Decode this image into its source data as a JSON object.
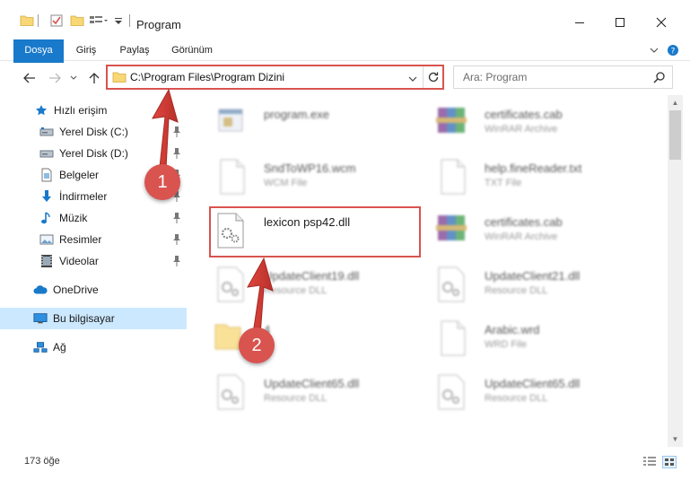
{
  "window": {
    "title": "Program",
    "controls": {
      "minimize": "—",
      "maximize": "☐",
      "close": "✕"
    }
  },
  "ribbon": {
    "tabs": [
      "Dosya",
      "Giriş",
      "Paylaş",
      "Görünüm"
    ]
  },
  "address_bar": {
    "path": "C:\\Program Files\\Program Dizini"
  },
  "search": {
    "placeholder": "Ara: Program"
  },
  "navigation": {
    "quick_access": "Hızlı erişim",
    "items": [
      {
        "label": "Yerel Disk (C:)",
        "icon": "drive-icon"
      },
      {
        "label": "Yerel Disk (D:)",
        "icon": "drive-icon"
      },
      {
        "label": "Belgeler",
        "icon": "documents-icon"
      },
      {
        "label": "İndirmeler",
        "icon": "downloads-icon"
      },
      {
        "label": "Müzik",
        "icon": "music-icon"
      },
      {
        "label": "Resimler",
        "icon": "pictures-icon"
      },
      {
        "label": "Videolar",
        "icon": "videos-icon"
      }
    ],
    "onedrive": "OneDrive",
    "this_pc": "Bu bilgisayar",
    "network": "Ağ"
  },
  "files": {
    "left": [
      {
        "name": "program.exe",
        "type": ""
      },
      {
        "name": "SndToWP16.wcm",
        "type": "WCM File"
      },
      {
        "name": "lexicon psp42.dll",
        "type": ""
      },
      {
        "name": "UpdateClient19.dll",
        "type": "Resource DLL"
      },
      {
        "name": "4",
        "type": ""
      },
      {
        "name": "UpdateClient65.dll",
        "type": "Resource DLL"
      }
    ],
    "right": [
      {
        "name": "certificates.cab",
        "type": "WinRAR Archive"
      },
      {
        "name": "help.fineReader.txt",
        "type": "TXT File"
      },
      {
        "name": "certificates.cab",
        "type": "WinRAR Archive"
      },
      {
        "name": "UpdateClient21.dll",
        "type": "Resource DLL"
      },
      {
        "name": "Arabic.wrd",
        "type": "WRD File"
      },
      {
        "name": "UpdateClient65.dll",
        "type": "Resource DLL"
      }
    ]
  },
  "status": {
    "count_text": "173 öğe"
  },
  "annotations": {
    "step1": "1",
    "step2": "2"
  },
  "colors": {
    "accent": "#1979ca",
    "highlight": "#d9534f",
    "selected": "#cce8ff"
  }
}
